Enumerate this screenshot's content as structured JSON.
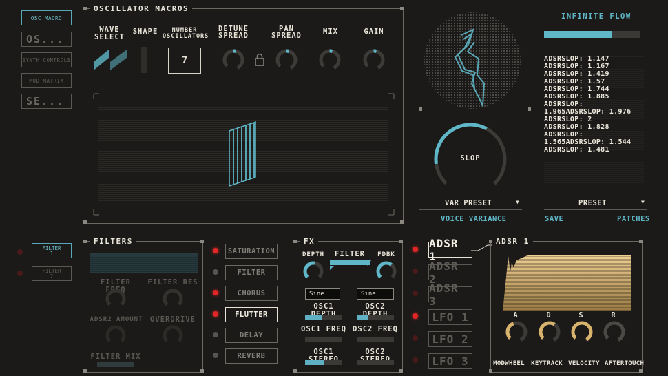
{
  "nav": {
    "items": [
      {
        "label": "OSC MACRO",
        "active": true
      },
      {
        "label": "OS..."
      },
      {
        "label": "SYNTH CONTROLS"
      },
      {
        "label": "MOD MATRIX"
      },
      {
        "label": "SE..."
      }
    ]
  },
  "osc": {
    "title": "OSCILLATOR MACROS",
    "wave_select": "WAVE\nSELECT",
    "shape": "SHAPE",
    "number_osc_line1": "NUMBER",
    "number_osc_line2": "OSCILLATORS",
    "number_value": "7",
    "detune_line1": "DETUNE",
    "detune_line2": "SPREAD",
    "pan_line1": "PAN",
    "pan_line2": "SPREAD",
    "mix": "MIX",
    "gain": "GAIN"
  },
  "slop": {
    "knob_label": "SLOP",
    "var_preset": "VAR PRESET",
    "voice_variance": "VOICE VARIANCE",
    "infinite_flow": "INFINITE FLOW",
    "preset": "PRESET",
    "save": "SAVE",
    "patches": "PATCHES",
    "log": [
      "ADSRSLOP: 1.147",
      "ADSRSLOP: 1.167",
      "ADSRSLOP: 1.419",
      "ADSRSLOP: 1.57",
      "ADSRSLOP: 1.744",
      "ADSRSLOP: 1.885",
      "ADSRSLOP:",
      "1.965ADSRSLOP: 1.976",
      "ADSRSLOP: 2",
      "ADSRSLOP: 1.828",
      "ADSRSLOP:",
      "1.565ADSRSLOP: 1.544",
      "ADSRSLOP: 1.481"
    ]
  },
  "filters": {
    "title": "FILTERS",
    "filter1_line1": "FILTER",
    "filter1_line2": "1",
    "filter2_line1": "FILTER",
    "filter2_line2": "2",
    "filter_freq": "FILTER FREQ",
    "filter_res": "FILTER RES",
    "adsr2_amount": "ADSR2 AMOUNT",
    "overdrive": "OVERDRIVE",
    "filter_mix": "FILTER MIX"
  },
  "fx_list": {
    "items": [
      {
        "label": "SATURATION",
        "led": "on"
      },
      {
        "label": "FILTER",
        "led": "off"
      },
      {
        "label": "CHORUS",
        "led": "on"
      },
      {
        "label": "FLUTTER",
        "led": "on",
        "active": true
      },
      {
        "label": "DELAY",
        "led": "off"
      },
      {
        "label": "REVERB",
        "led": "off"
      }
    ]
  },
  "fx": {
    "title": "FX",
    "depth": "DEPTH",
    "filter": "FILTER",
    "fdbk": "FDBK",
    "osc1_wave": "Sine",
    "osc2_wave": "Sine",
    "osc1_depth": "OSC1 DEPTH",
    "osc2_depth": "OSC2 DEPTH",
    "osc1_freq": "OSC1 FREQ",
    "osc2_freq": "OSC2 FREQ",
    "osc1_stereo": "OSC1 STEREO",
    "osc2_stereo": "OSC2 STEREO",
    "osc1_depth_val": 0.47,
    "osc2_depth_val": 0.3,
    "osc1_freq_val": 0.0,
    "osc2_freq_val": 0.0,
    "osc1_stereo_val": 0.5,
    "osc2_stereo_val": 0.0
  },
  "mods": {
    "items": [
      {
        "label": "ADSR 1",
        "led": "on",
        "active": true
      },
      {
        "label": "ADSR 2",
        "led": "dark"
      },
      {
        "label": "ADSR 3",
        "led": "dark"
      },
      {
        "label": "LFO 1",
        "led": "on"
      },
      {
        "label": "LFO 2",
        "led": "dark"
      },
      {
        "label": "LFO 3",
        "led": "dark"
      }
    ]
  },
  "adsr": {
    "title": "ADSR 1",
    "a": "A",
    "d": "D",
    "s": "S",
    "r": "R",
    "modwheel": "MODWHEEL",
    "keytrack": "KEYTRACK",
    "velocity": "VELOCITY",
    "aftertouch": "AFTERTOUCH"
  },
  "colors": {
    "accent": "#5fb7c8",
    "amber": "#d8b36e",
    "red": "#e02626"
  }
}
